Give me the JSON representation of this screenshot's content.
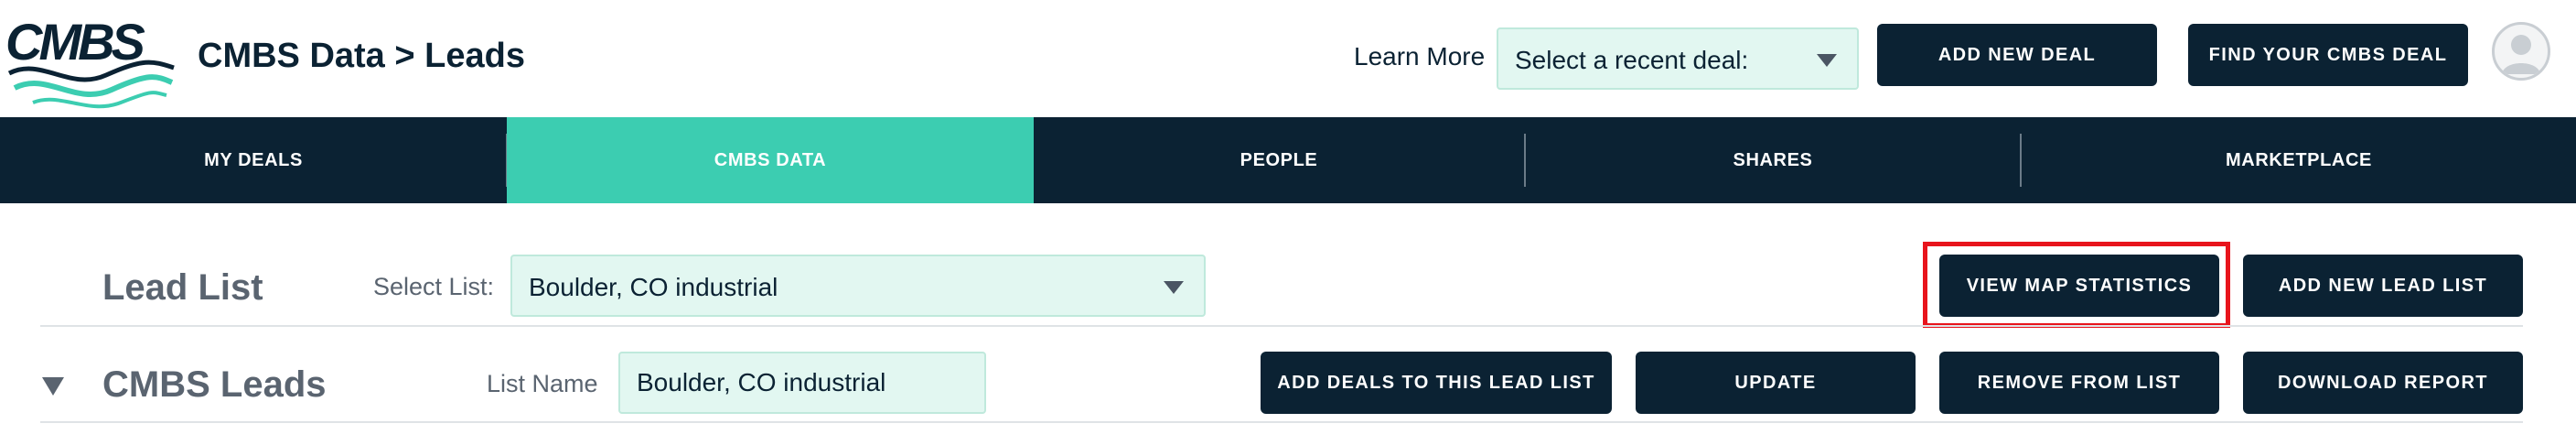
{
  "header": {
    "logo_text": "CMBS",
    "breadcrumb": {
      "section": "CMBS Data",
      "separator": ">",
      "page": "Leads"
    },
    "learn_more": "Learn More",
    "recent_deal_select": {
      "value": "Select a recent deal:"
    },
    "add_new_deal": "ADD NEW DEAL",
    "find_deal": "FIND YOUR CMBS DEAL"
  },
  "nav": {
    "items": [
      {
        "label": "MY DEALS",
        "active": false
      },
      {
        "label": "CMBS DATA",
        "active": true
      },
      {
        "label": "PEOPLE",
        "active": false
      },
      {
        "label": "SHARES",
        "active": false
      },
      {
        "label": "MARKETPLACE",
        "active": false
      }
    ]
  },
  "lead_list": {
    "title": "Lead List",
    "select_label": "Select List:",
    "selected_list": "Boulder, CO industrial",
    "view_map_statistics": "VIEW MAP STATISTICS",
    "add_new_lead_list": "ADD NEW LEAD LIST"
  },
  "cmbs_leads": {
    "title": "CMBS Leads",
    "list_name_label": "List Name",
    "list_name_value": "Boulder, CO industrial",
    "add_deals": "ADD DEALS TO THIS LEAD LIST",
    "update": "UPDATE",
    "remove_from_list": "REMOVE FROM LIST",
    "download_report": "DOWNLOAD REPORT"
  },
  "colors": {
    "navy": "#0b2233",
    "teal_active": "#3ccdb1",
    "input_bg": "#e2f7f1",
    "highlight_red": "#e8141c"
  },
  "icons": {
    "logo": "cmbs-wave-logo",
    "avatar": "user-avatar-icon",
    "select_caret": "caret-down-icon",
    "collapse": "triangle-down-icon"
  }
}
